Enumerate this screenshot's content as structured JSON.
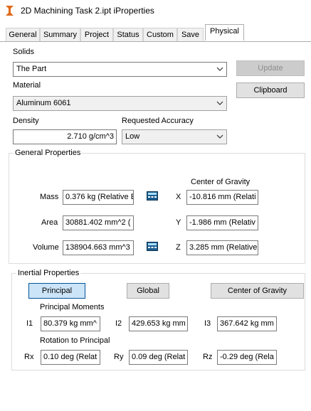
{
  "window": {
    "title": "2D Machining Task 2.ipt iProperties"
  },
  "tabs": [
    {
      "label": "General"
    },
    {
      "label": "Summary"
    },
    {
      "label": "Project"
    },
    {
      "label": "Status"
    },
    {
      "label": "Custom"
    },
    {
      "label": "Save"
    },
    {
      "label": "Physical"
    }
  ],
  "active_tab": "Physical",
  "solids": {
    "label": "Solids",
    "selected": "The Part"
  },
  "material": {
    "label": "Material",
    "selected": "Aluminum 6061"
  },
  "density": {
    "label": "Density",
    "value": "2.710 g/cm^3"
  },
  "accuracy": {
    "label": "Requested Accuracy",
    "selected": "Low"
  },
  "buttons": {
    "update": "Update",
    "clipboard": "Clipboard"
  },
  "general": {
    "title": "General Properties",
    "cog_label": "Center of Gravity",
    "mass_label": "Mass",
    "mass_value": "0.376 kg (Relative E",
    "area_label": "Area",
    "area_value": "30881.402 mm^2 (",
    "volume_label": "Volume",
    "volume_value": "138904.663 mm^3",
    "x_label": "X",
    "x_value": "-10.816 mm (Relati",
    "y_label": "Y",
    "y_value": "-1.986 mm (Relativ",
    "z_label": "Z",
    "z_value": "3.285 mm (Relative"
  },
  "inertial": {
    "title": "Inertial Properties",
    "btn_principal": "Principal",
    "btn_global": "Global",
    "btn_cog": "Center of Gravity",
    "moments_label": "Principal Moments",
    "i1_label": "I1",
    "i1_value": "80.379 kg mm^",
    "i2_label": "I2",
    "i2_value": "429.653 kg mm",
    "i3_label": "I3",
    "i3_value": "367.642 kg mm",
    "rotation_label": "Rotation to Principal",
    "rx_label": "Rx",
    "rx_value": "0.10 deg (Relat",
    "ry_label": "Ry",
    "ry_value": "0.09 deg (Relat",
    "rz_label": "Rz",
    "rz_value": "-0.29 deg (Rela"
  },
  "icons": {
    "app": "inventor-app-icon",
    "dropdown": "chevron-down-icon",
    "calculator": "calculator-icon"
  }
}
